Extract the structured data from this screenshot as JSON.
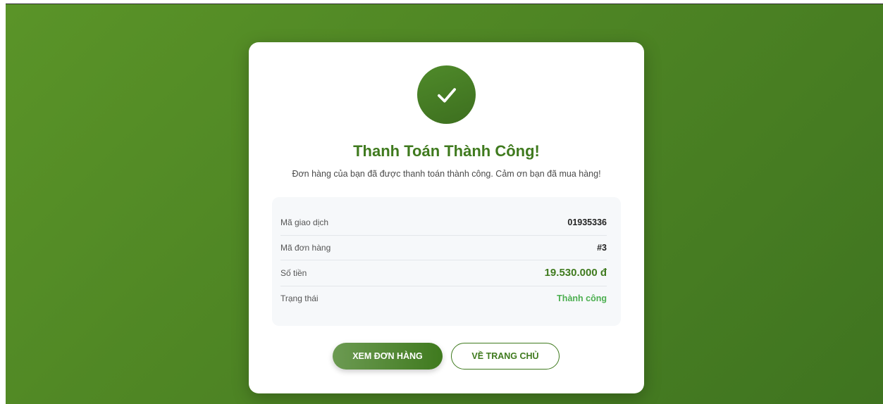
{
  "header": {
    "title": "Thanh Toán Thành Công!",
    "message": "Đơn hàng của bạn đã được thanh toán thành công. Cảm ơn bạn đã mua hàng!"
  },
  "icons": {
    "status": "check-icon"
  },
  "details": {
    "rows": [
      {
        "label": "Mã giao dịch",
        "value": "01935336"
      },
      {
        "label": "Mã đơn hàng",
        "value": "#3"
      },
      {
        "label": "Số tiền",
        "value": "19.530.000 đ"
      },
      {
        "label": "Trạng thái",
        "value": "Thành công"
      }
    ]
  },
  "actions": {
    "view_order": "XEM ĐƠN HÀNG",
    "home": "VỀ TRANG CHỦ"
  },
  "colors": {
    "brand_green": "#3f7a1e",
    "background_green": "#4e8524",
    "status_green": "#4caf50"
  }
}
